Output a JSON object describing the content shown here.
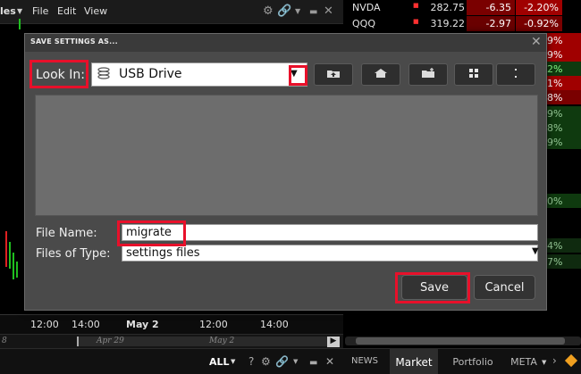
{
  "app": {
    "menu_partial": "les",
    "menu": [
      "File",
      "Edit",
      "View"
    ]
  },
  "watchlist": [
    {
      "symbol": "NVDA",
      "price": "282.75",
      "change": "-6.35",
      "percent": "-2.20%"
    },
    {
      "symbol": "QQQ",
      "price": "319.22",
      "change": "-2.97",
      "percent": "-0.92%"
    }
  ],
  "percent_column": [
    "9%",
    "9%",
    "2%",
    "1%",
    "8%",
    "9%",
    "8%",
    "9%",
    "0%",
    "4%",
    "7%"
  ],
  "chart": {
    "time_ticks": [
      "12:00",
      "14:00",
      "May 2",
      "12:00",
      "14:00"
    ],
    "scroll_dates": [
      "8",
      "Apr 29",
      "May 2"
    ]
  },
  "dialog": {
    "title": "SAVE SETTINGS AS...",
    "look_in_label": "Look In:",
    "look_in_value": "USB Drive",
    "file_name_label": "File Name:",
    "file_name_value": "migrate",
    "files_of_type_label": "Files of Type:",
    "files_of_type_value": "settings files",
    "save_label": "Save",
    "cancel_label": "Cancel"
  },
  "bottom": {
    "all_label": "ALL",
    "tabs": [
      "NEWS",
      "Market",
      "Portfolio",
      "META"
    ]
  },
  "colors": {
    "highlight": "#e8102a",
    "negative_bg": "#a00000",
    "positive_bg": "#0f3a0f",
    "dialog_bg": "#4a4a4a"
  }
}
